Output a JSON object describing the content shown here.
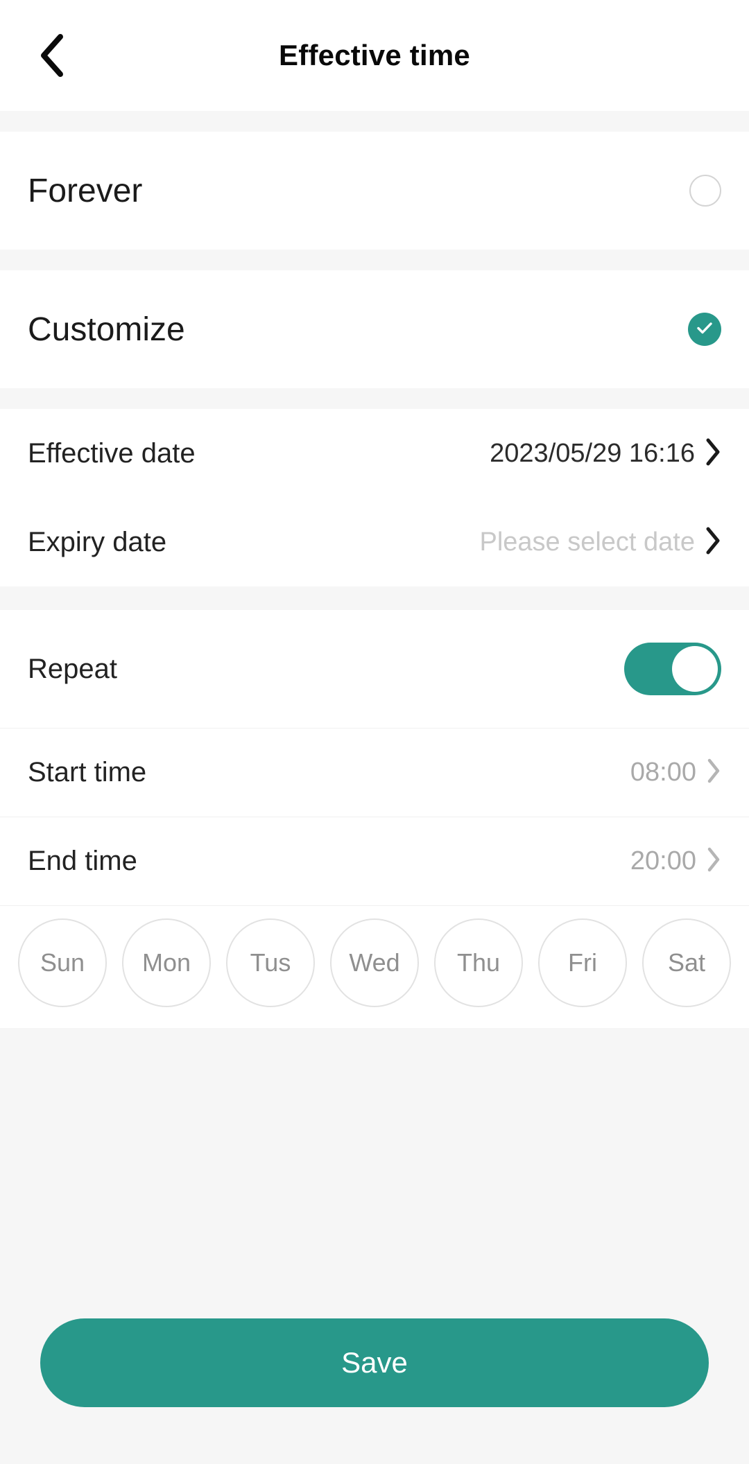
{
  "header": {
    "title": "Effective time",
    "back_icon": "chevron-left-icon"
  },
  "mode": {
    "forever": {
      "label": "Forever",
      "selected": false
    },
    "customize": {
      "label": "Customize",
      "selected": true,
      "check_icon": "check-icon"
    }
  },
  "dates": {
    "effective": {
      "label": "Effective date",
      "value": "2023/05/29 16:16",
      "chevron_icon": "chevron-right-icon"
    },
    "expiry": {
      "label": "Expiry date",
      "placeholder": "Please select date",
      "chevron_icon": "chevron-right-icon"
    }
  },
  "schedule": {
    "repeat": {
      "label": "Repeat",
      "enabled": true
    },
    "start_time": {
      "label": "Start time",
      "value": "08:00",
      "chevron_icon": "chevron-right-icon"
    },
    "end_time": {
      "label": "End time",
      "value": "20:00",
      "chevron_icon": "chevron-right-icon"
    },
    "days": [
      {
        "label": "Sun",
        "selected": false
      },
      {
        "label": "Mon",
        "selected": false
      },
      {
        "label": "Tus",
        "selected": false
      },
      {
        "label": "Wed",
        "selected": false
      },
      {
        "label": "Thu",
        "selected": false
      },
      {
        "label": "Fri",
        "selected": false
      },
      {
        "label": "Sat",
        "selected": false
      }
    ]
  },
  "footer": {
    "save_label": "Save"
  },
  "colors": {
    "accent": "#28988a",
    "page_bg": "#f6f6f6",
    "card_bg": "#ffffff",
    "text_primary": "#222222",
    "text_muted": "#c8c8c8"
  }
}
